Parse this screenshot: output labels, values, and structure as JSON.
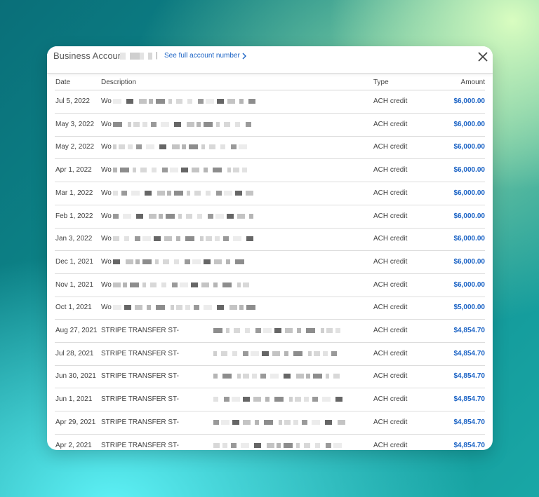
{
  "header": {
    "account_label": "Business Account",
    "separator": "|",
    "see_full_label": "See full account number"
  },
  "table": {
    "columns": {
      "date": "Date",
      "description": "Description",
      "type": "Type",
      "amount": "Amount"
    },
    "rows": [
      {
        "date": "Jul 5, 2022",
        "description": "Wo",
        "type": "ACH credit",
        "amount": "$6,000.00"
      },
      {
        "date": "May 3, 2022",
        "description": "Wo",
        "type": "ACH credit",
        "amount": "$6,000.00"
      },
      {
        "date": "May 2, 2022",
        "description": "Wo",
        "type": "ACH credit",
        "amount": "$6,000.00"
      },
      {
        "date": "Apr 1, 2022",
        "description": "Wo",
        "type": "ACH credit",
        "amount": "$6,000.00"
      },
      {
        "date": "Mar 1, 2022",
        "description": "Wo",
        "type": "ACH credit",
        "amount": "$6,000.00"
      },
      {
        "date": "Feb 1, 2022",
        "description": "Wo",
        "type": "ACH credit",
        "amount": "$6,000.00"
      },
      {
        "date": "Jan 3, 2022",
        "description": "Wo",
        "type": "ACH credit",
        "amount": "$6,000.00"
      },
      {
        "date": "Dec 1, 2021",
        "description": "Wo",
        "type": "ACH credit",
        "amount": "$6,000.00"
      },
      {
        "date": "Nov 1, 2021",
        "description": "Wo",
        "type": "ACH credit",
        "amount": "$6,000.00"
      },
      {
        "date": "Oct 1, 2021",
        "description": "Wo",
        "type": "ACH credit",
        "amount": "$5,000.00"
      },
      {
        "date": "Aug 27, 2021",
        "description": "STRIPE TRANSFER ST-",
        "type": "ACH credit",
        "amount": "$4,854.70"
      },
      {
        "date": "Jul 28, 2021",
        "description": "STRIPE TRANSFER ST-",
        "type": "ACH credit",
        "amount": "$4,854.70"
      },
      {
        "date": "Jun 30, 2021",
        "description": "STRIPE TRANSFER ST-",
        "type": "ACH credit",
        "amount": "$4,854.70"
      },
      {
        "date": "Jun 1, 2021",
        "description": "STRIPE TRANSFER ST-",
        "type": "ACH credit",
        "amount": "$4,854.70"
      },
      {
        "date": "Apr 29, 2021",
        "description": "STRIPE TRANSFER ST-",
        "type": "ACH credit",
        "amount": "$4,854.70"
      },
      {
        "date": "Apr 2, 2021",
        "description": "STRIPE TRANSFER ST-",
        "type": "ACH credit",
        "amount": "$4,854.70"
      }
    ]
  },
  "colors": {
    "amount": "#1b63c5",
    "link": "#1b63c5",
    "background_teal": "#0d8a8c",
    "background_lime": "#d9fdc0"
  },
  "icons": {
    "close": "close-icon",
    "chevron": "chevron-right-icon"
  }
}
